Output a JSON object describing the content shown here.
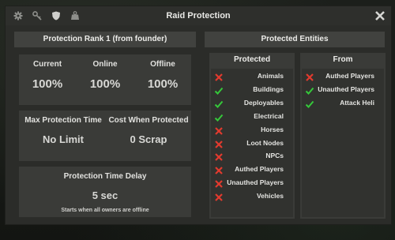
{
  "window": {
    "title": "Raid Protection"
  },
  "toolbar": {
    "icons": [
      "gear-icon",
      "key-icon",
      "shield-icon",
      "weight-icon"
    ]
  },
  "left": {
    "rank_header": "Protection Rank 1 (from founder)",
    "stats": [
      {
        "label": "Current",
        "value": "100%"
      },
      {
        "label": "Online",
        "value": "100%"
      },
      {
        "label": "Offline",
        "value": "100%"
      }
    ],
    "max_time_label": "Max Protection Time",
    "max_time_value": "No Limit",
    "cost_label": "Cost When Protected",
    "cost_value": "0 Scrap",
    "delay_label": "Protection Time Delay",
    "delay_value": "5 sec",
    "delay_note": "Starts when all owners are offline"
  },
  "right": {
    "header": "Protected Entities",
    "protected_header": "Protected",
    "from_header": "From",
    "protected": [
      {
        "label": "Animals",
        "state": "cross"
      },
      {
        "label": "Buildings",
        "state": "tick"
      },
      {
        "label": "Deployables",
        "state": "tick"
      },
      {
        "label": "Electrical",
        "state": "tick"
      },
      {
        "label": "Horses",
        "state": "cross"
      },
      {
        "label": "Loot Nodes",
        "state": "cross"
      },
      {
        "label": "NPCs",
        "state": "cross"
      },
      {
        "label": "Authed Players",
        "state": "cross"
      },
      {
        "label": "Unauthed Players",
        "state": "cross"
      },
      {
        "label": "Vehicles",
        "state": "cross"
      }
    ],
    "from": [
      {
        "label": "Authed Players",
        "state": "cross"
      },
      {
        "label": "Unauthed Players",
        "state": "tick"
      },
      {
        "label": "Attack Heli",
        "state": "tick"
      }
    ]
  },
  "colors": {
    "tick": "#35c83a",
    "cross": "#e23a2e",
    "panel": "#3a3b38",
    "window": "#2b2c29"
  }
}
